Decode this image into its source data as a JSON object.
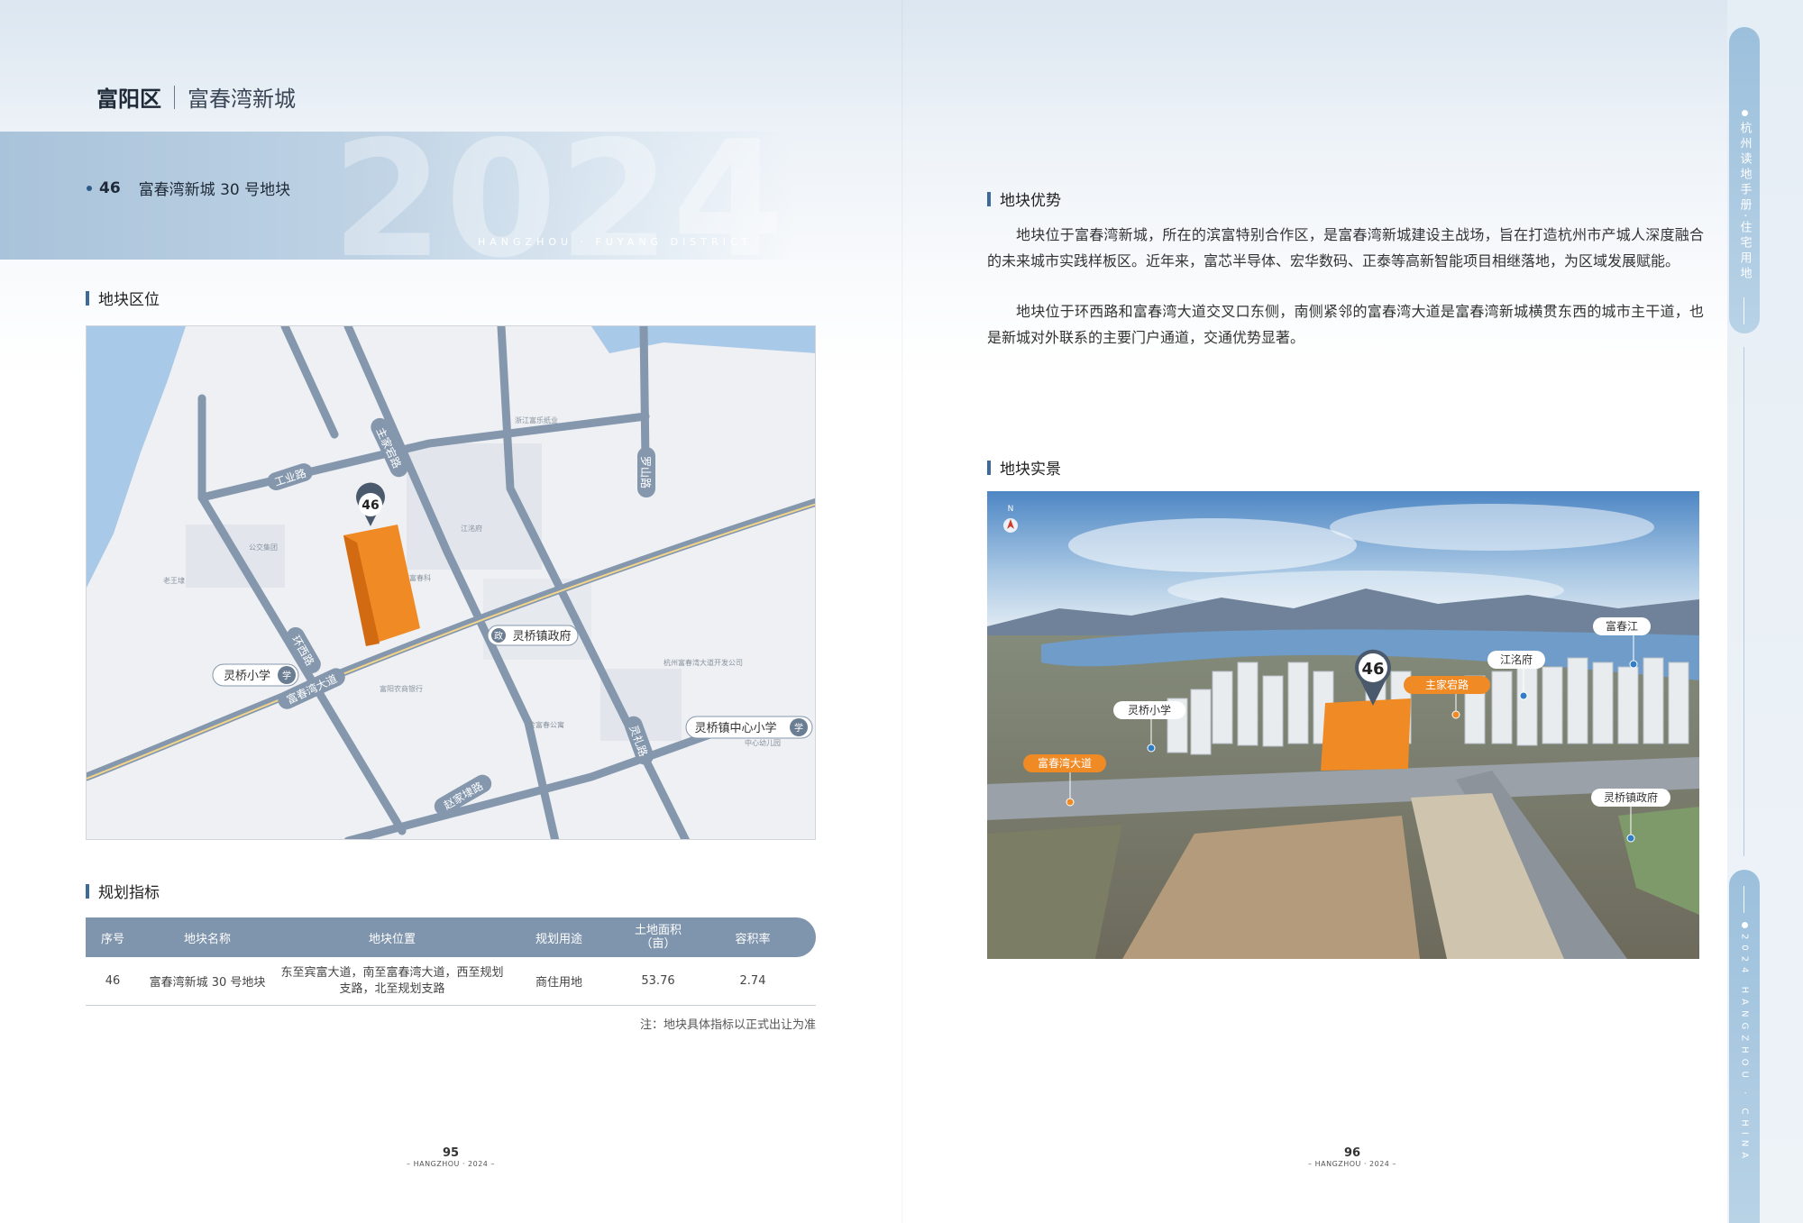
{
  "header": {
    "district": "富阳区",
    "area": "富春湾新城"
  },
  "banner": {
    "year": "2024",
    "subtitle": "HANGZHOU · FUYANG DISTRICT"
  },
  "lot": {
    "number": "46",
    "name": "富春湾新城 30 号地块"
  },
  "sections": {
    "location": "地块区位",
    "indicators": "规划指标",
    "advantages": "地块优势",
    "reality": "地块实景"
  },
  "map": {
    "pin": "46",
    "road_labels": [
      "工业路",
      "主家宕路",
      "罗山路",
      "环西路",
      "富春湾大道",
      "灵礼路",
      "赵家埭路"
    ],
    "poi": {
      "gov": "灵桥镇政府",
      "gov_badge": "政",
      "school1": "灵桥小学",
      "school2": "灵桥镇中心小学",
      "school_badge": "学"
    },
    "small_labels": [
      "浙江富乐纸业",
      "江洺府",
      "富春科",
      "杭州富春湾大道开发公司",
      "中心幼儿园",
      "富阳农商银行",
      "金富春公寓",
      "老王埭",
      "公交集团"
    ]
  },
  "table": {
    "headers": [
      "序号",
      "地块名称",
      "地块位置",
      "规划用途",
      "土地面积\n（亩）",
      "容积率"
    ],
    "rows": [
      {
        "no": "46",
        "name": "富春湾新城 30 号地块",
        "location": "东至宾富大道，南至富春湾大道，西至规划支路，北至规划支路",
        "use": "商住用地",
        "area": "53.76",
        "far": "2.74"
      }
    ],
    "note": "注：地块具体指标以正式出让为准"
  },
  "advantages": {
    "p1": "地块位于富春湾新城，所在的滨富特别合作区，是富春湾新城建设主战场，旨在打造杭州市产城人深度融合的未来城市实践样板区。近年来，富芯半导体、宏华数码、正泰等高新智能项目相继落地，为区域发展赋能。",
    "p2": "地块位于环西路和富春湾大道交叉口东侧，南侧紧邻的富春湾大道是富春湾新城横贯东西的城市主干道，也是新城对外联系的主要门户通道，交通优势显著。"
  },
  "photo": {
    "pin": "46",
    "north": "N",
    "labels": {
      "river": "富春江",
      "jiangming": "江洺府",
      "zhujia": "主家宕路",
      "school": "灵桥小学",
      "avenue": "富春湾大道",
      "gov": "灵桥镇政府"
    }
  },
  "footer": {
    "left_page": "95",
    "right_page": "96",
    "left_sub": "– HANGZHOU · 2024 –",
    "right_sub": "– HANGZHOU · 2024 –"
  },
  "rail": {
    "tab1": "杭州读地手册·住宅用地",
    "tab2": "2024 HANGZHOU · CHINA"
  },
  "colors": {
    "accent": "#f08a24",
    "road": "#8a9bb0",
    "header_blue": "#7f95ad"
  }
}
